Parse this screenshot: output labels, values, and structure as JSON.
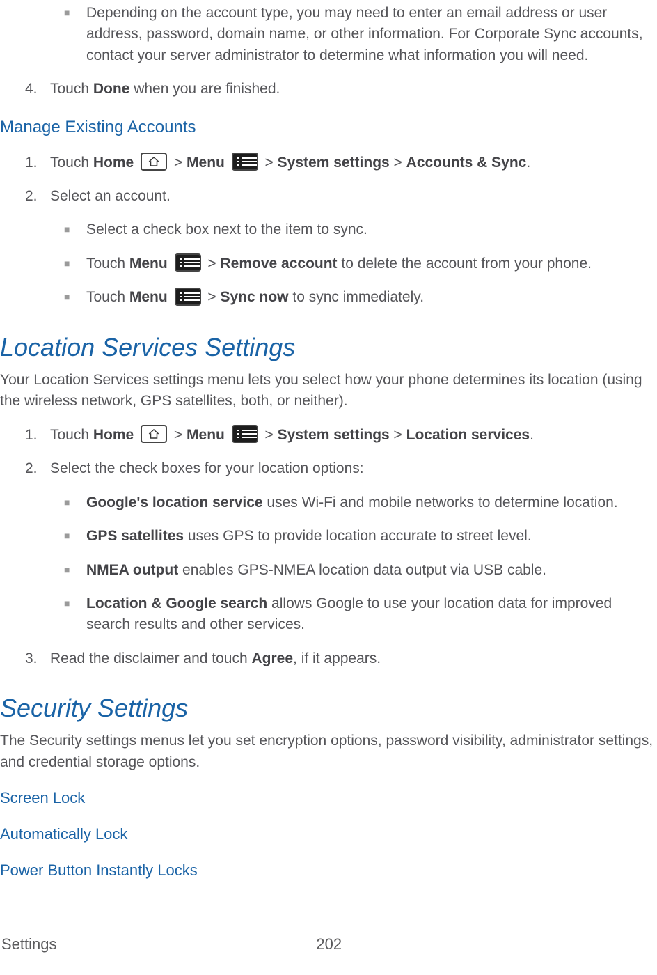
{
  "top_bullet": "Depending on the account type, you may need to enter an email address or user address, password, domain name, or other information. For Corporate Sync accounts, contact your server administrator to determine what information you will need.",
  "top_step4_prefix": "4.",
  "top_step4_t1": "Touch ",
  "top_step4_bold": "Done",
  "top_step4_t2": " when you are finished.",
  "manage_heading": "Manage Existing Accounts",
  "m1_num": "1.",
  "m1_t1": "Touch ",
  "m1_b1": "Home",
  "m1_t2": " > ",
  "m1_b2": "Menu",
  "m1_t3": " > ",
  "m1_b3": "System settings",
  "m1_t4": " > ",
  "m1_b4": "Accounts & Sync",
  "m1_t5": ".",
  "m2_num": "2.",
  "m2_text": "Select an account.",
  "m2_a": "Select a check box next to the item to sync.",
  "m2_b_t1": "Touch ",
  "m2_b_b1": "Menu",
  "m2_b_t2": " > ",
  "m2_b_b2": "Remove account",
  "m2_b_t3": " to delete the account from your phone.",
  "m2_c_t1": "Touch ",
  "m2_c_b1": "Menu",
  "m2_c_t2": " > ",
  "m2_c_b2": "Sync now",
  "m2_c_t3": " to sync immediately.",
  "loc_heading": "Location Services Settings",
  "loc_intro": "Your Location Services settings menu lets you select how your phone determines its location (using the wireless network, GPS satellites, both, or neither).",
  "l1_num": "1.",
  "l1_t1": "Touch ",
  "l1_b1": "Home",
  "l1_t2": " > ",
  "l1_b2": "Menu",
  "l1_t3": " > ",
  "l1_b3": "System settings",
  "l1_t4": " > ",
  "l1_b4": "Location services",
  "l1_t5": ".",
  "l2_num": "2.",
  "l2_text": "Select the check boxes for your location options:",
  "l2_a_b": "Google's location service",
  "l2_a_t": " uses Wi-Fi and mobile networks to determine location.",
  "l2_b_b": "GPS satellites",
  "l2_b_t": " uses GPS to provide location accurate to street level.",
  "l2_c_b": "NMEA output",
  "l2_c_t": " enables GPS-NMEA location data output via USB cable.",
  "l2_d_b": "Location & Google search",
  "l2_d_t": " allows Google to use your location data for improved search results and other services.",
  "l3_num": "3.",
  "l3_t1": "Read the disclaimer and touch ",
  "l3_b1": "Agree",
  "l3_t2": ", if it appears.",
  "sec_heading": "Security Settings",
  "sec_intro": "The Security settings menus let you set encryption options, password visibility, administrator settings, and credential storage options.",
  "link1": "Screen Lock",
  "link2": "Automatically Lock",
  "link3": "Power Button Instantly Locks",
  "footer_left": "Settings",
  "footer_center": "202"
}
